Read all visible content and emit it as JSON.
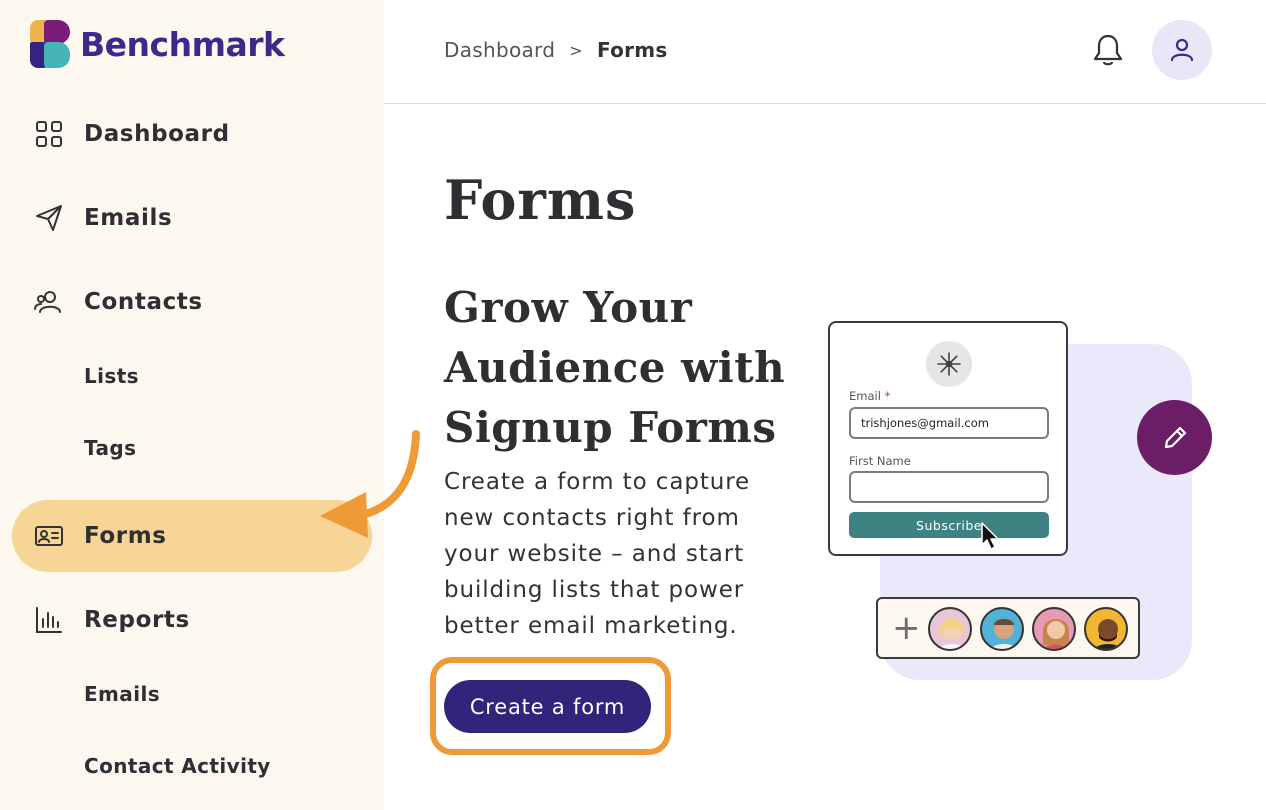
{
  "brand": {
    "name": "Benchmark"
  },
  "sidebar": {
    "items": [
      {
        "label": "Dashboard",
        "icon": "grid-icon"
      },
      {
        "label": "Emails",
        "icon": "paper-plane-icon"
      },
      {
        "label": "Contacts",
        "icon": "users-icon"
      },
      {
        "label": "Lists",
        "sub": true
      },
      {
        "label": "Tags",
        "sub": true
      },
      {
        "label": "Forms",
        "icon": "id-card-icon",
        "active": true
      },
      {
        "label": "Reports",
        "icon": "bar-chart-icon"
      },
      {
        "label": "Emails",
        "sub": true
      },
      {
        "label": "Contact Activity",
        "sub": true
      }
    ]
  },
  "header": {
    "breadcrumb": {
      "parent": "Dashboard",
      "separator": ">",
      "current": "Forms"
    }
  },
  "main": {
    "title": "Forms",
    "headline": "Grow Your Audience with Signup Forms",
    "description": "Create a form to capture new contacts right from your website – and start building lists that power better email marketing.",
    "cta_label": "Create a form"
  },
  "illustration": {
    "email_label": "Email",
    "required_mark": "*",
    "email_value": "trishjones@gmail.com",
    "first_name_label": "First Name",
    "first_name_value": "",
    "subscribe_label": "Subscribe",
    "plus_symbol": "+"
  },
  "colors": {
    "sidebar_bg": "#fdf8ef",
    "active_item": "#f6d597",
    "primary": "#33237a",
    "highlight": "#ef9a36",
    "accent_purple": "#6b1e66",
    "subscribe": "#3e8282"
  }
}
